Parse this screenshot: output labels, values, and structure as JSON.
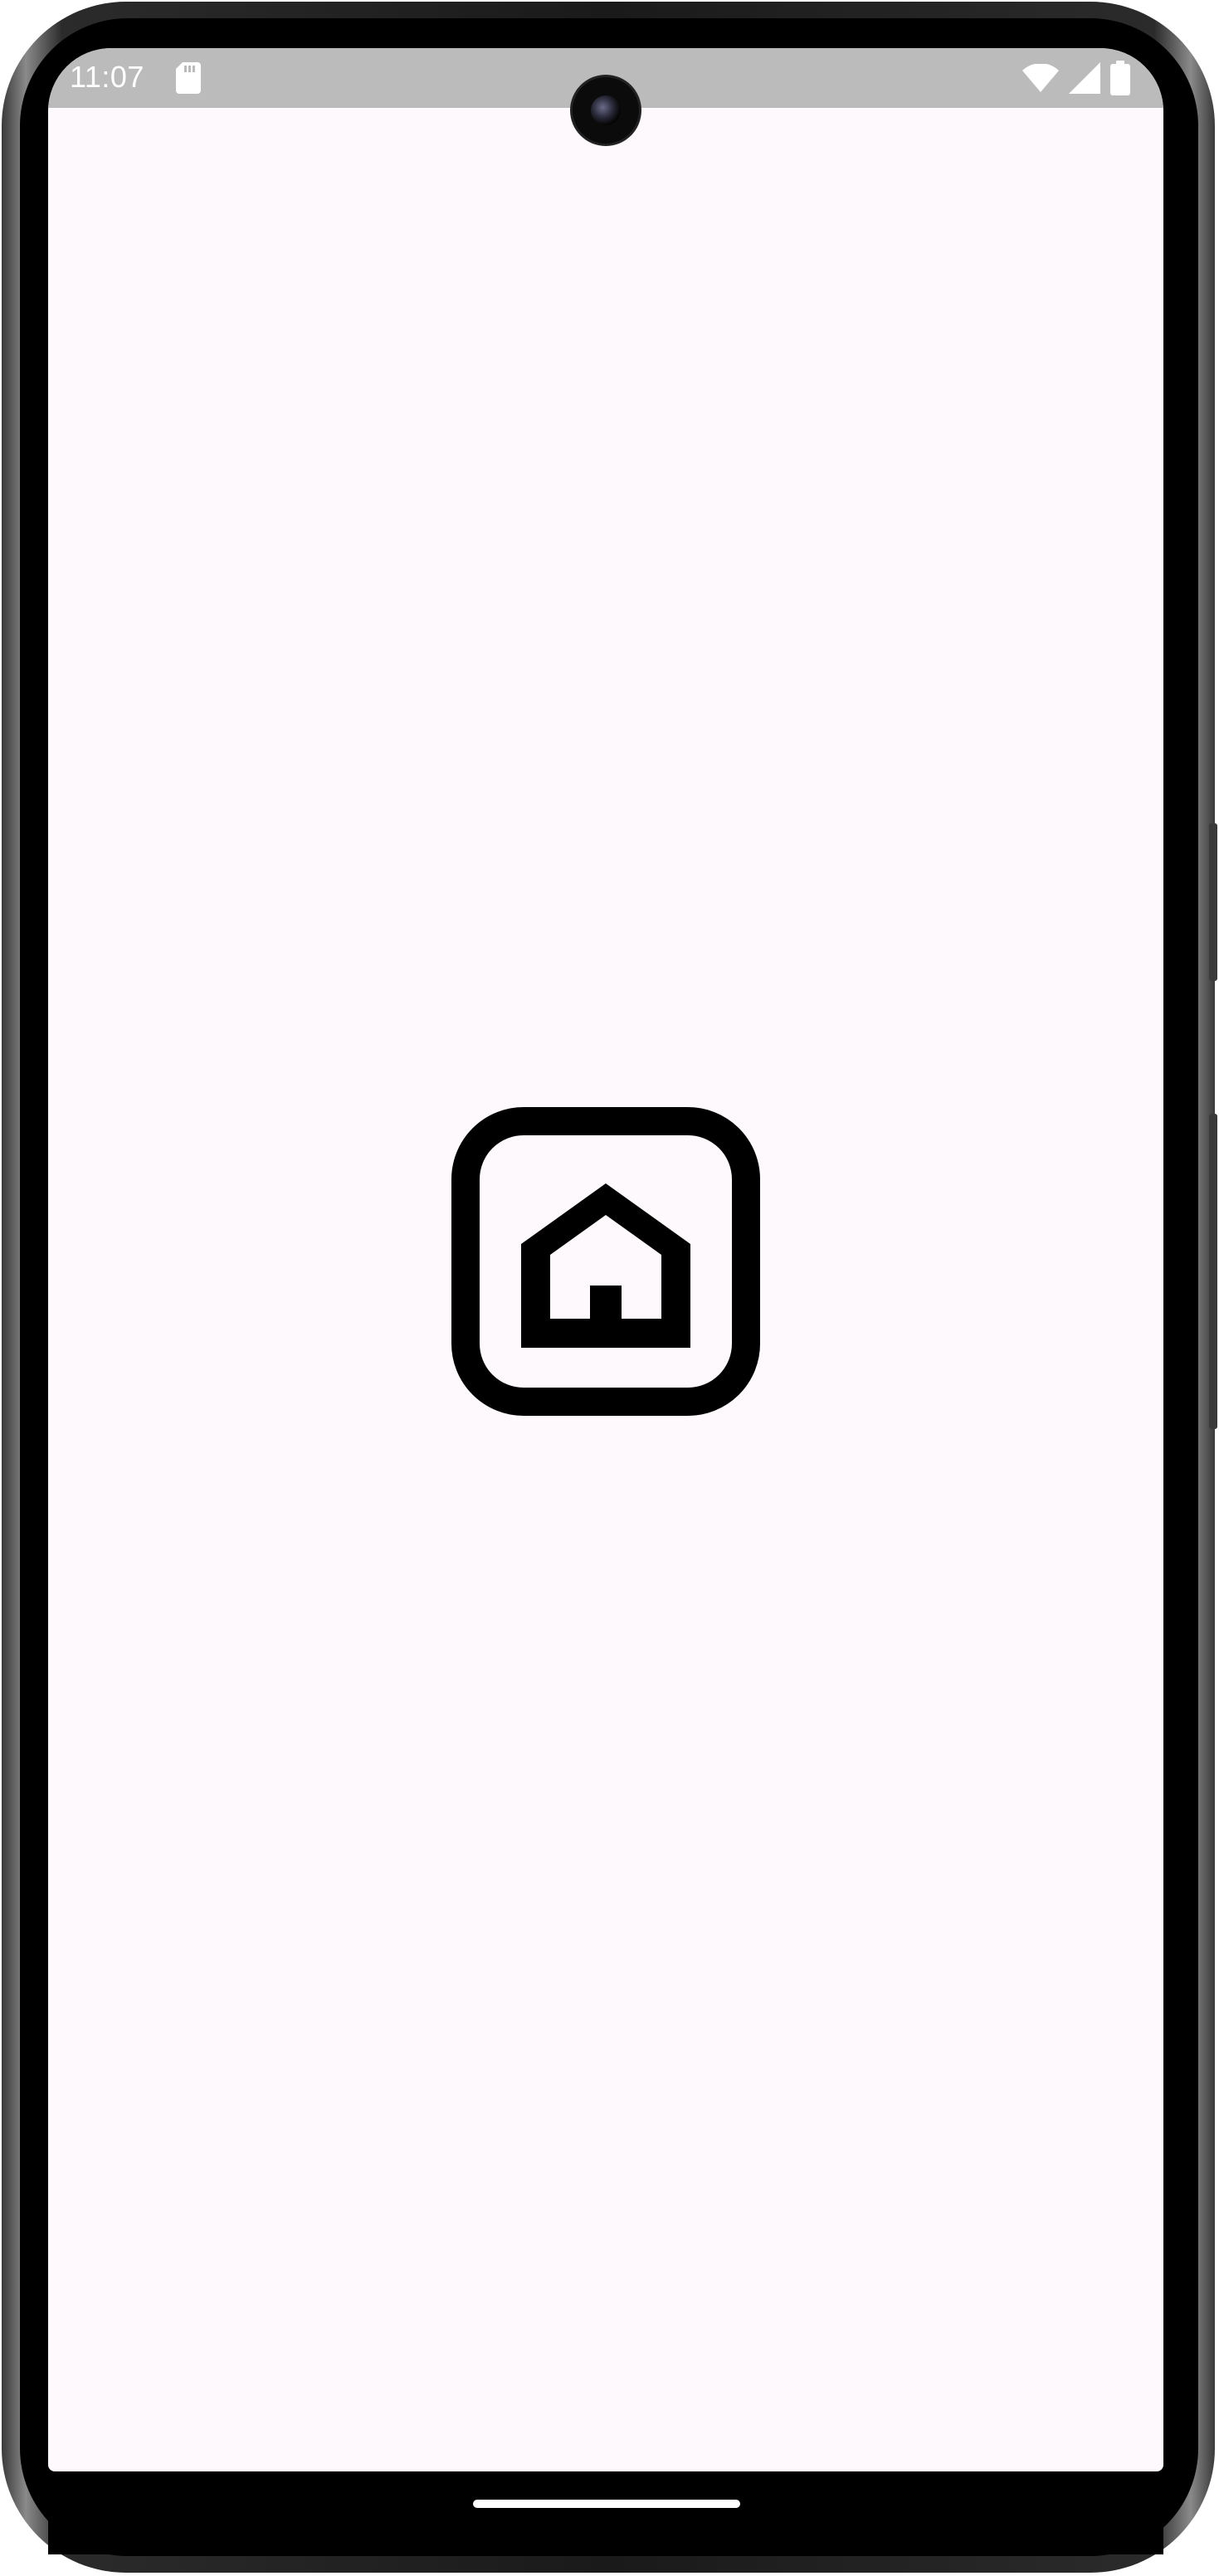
{
  "status_bar": {
    "time": "11:07",
    "icons": [
      "sd-card-icon",
      "wifi-icon",
      "cell-signal-icon",
      "battery-icon"
    ]
  },
  "main": {
    "center_icon": "home-icon",
    "background": "#fdf9fc"
  },
  "nav": {
    "gesture_handle": "gesture-handle"
  },
  "colors": {
    "status_bar": "#bcbbbc",
    "icon": "#000000"
  }
}
